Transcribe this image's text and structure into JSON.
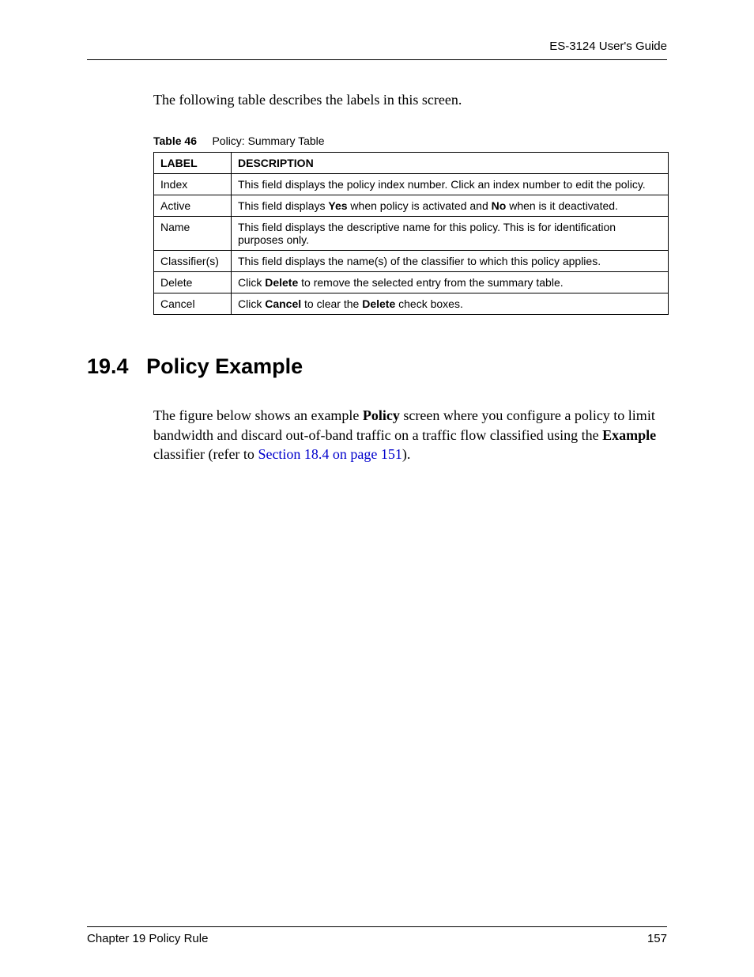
{
  "header": {
    "guide": "ES-3124 User's Guide"
  },
  "intro": "The following table describes the labels in this screen.",
  "table": {
    "caption_prefix": "Table 46",
    "caption_title": "Policy: Summary Table",
    "header_label": "LABEL",
    "header_description": "DESCRIPTION",
    "rows": {
      "r0": {
        "label": "Index",
        "desc": "This field displays the policy index number. Click an index number to edit the policy."
      },
      "r1": {
        "label": "Active",
        "desc_a": "This field displays ",
        "desc_b": "Yes",
        "desc_c": " when policy is activated and ",
        "desc_d": "No",
        "desc_e": " when is it deactivated."
      },
      "r2": {
        "label": "Name",
        "desc": "This field displays the descriptive name for this policy. This is for identification purposes only."
      },
      "r3": {
        "label": "Classifier(s)",
        "desc": "This field displays the name(s) of the classifier to which this policy applies."
      },
      "r4": {
        "label": "Delete",
        "desc_a": "Click ",
        "desc_b": "Delete",
        "desc_c": " to remove the selected entry from the summary table."
      },
      "r5": {
        "label": "Cancel",
        "desc_a": "Click ",
        "desc_b": "Cancel",
        "desc_c": " to clear the ",
        "desc_d": "Delete",
        "desc_e": " check boxes."
      }
    }
  },
  "section": {
    "number": "19.4",
    "title": "Policy Example"
  },
  "paragraph": {
    "p1": "The figure below shows an example ",
    "p2": "Policy",
    "p3": " screen where you configure a policy to limit bandwidth and discard out-of-band traffic on a traffic flow classified using the ",
    "p4": "Example",
    "p5": " classifier (refer to ",
    "link": "Section 18.4 on page 151",
    "p6": ")."
  },
  "footer": {
    "chapter": "Chapter 19 Policy Rule",
    "page": "157"
  }
}
